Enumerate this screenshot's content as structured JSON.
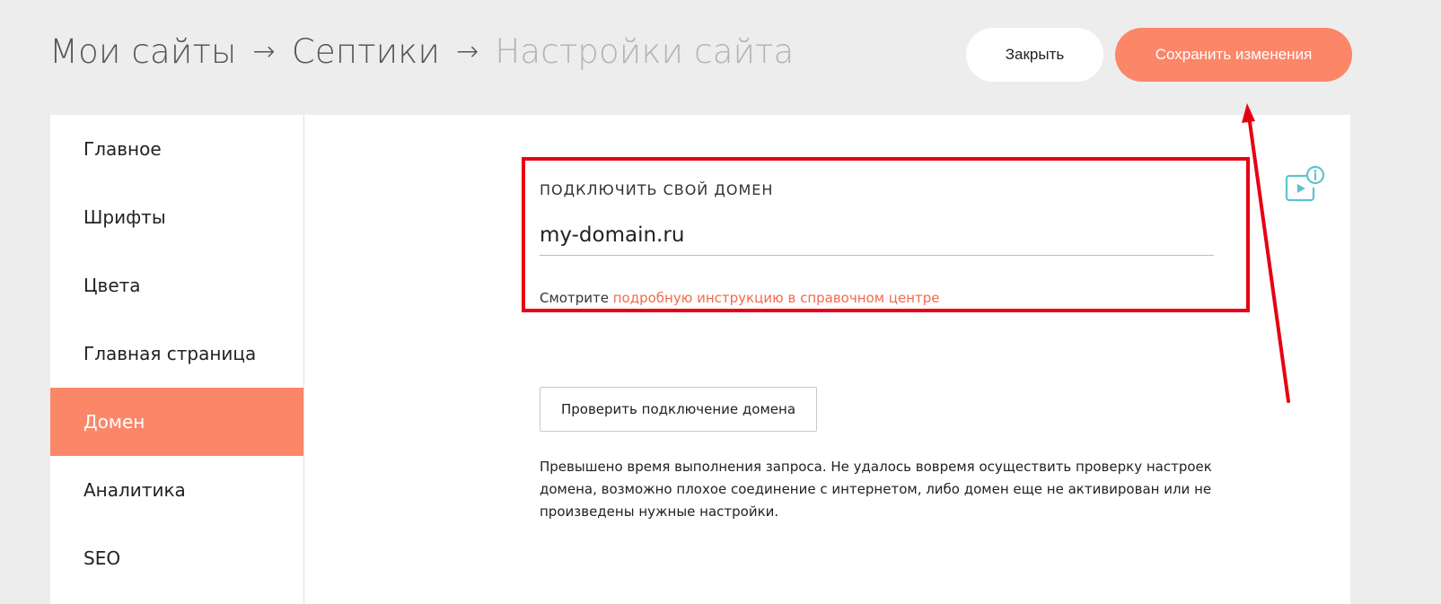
{
  "breadcrumb": {
    "items": [
      "Мои сайты",
      "Септики"
    ],
    "current": "Настройки сайта",
    "separator": "→"
  },
  "header": {
    "close_label": "Закрыть",
    "save_label": "Сохранить изменения"
  },
  "sidebar": {
    "items": [
      {
        "label": "Главное"
      },
      {
        "label": "Шрифты"
      },
      {
        "label": "Цвета"
      },
      {
        "label": "Главная страница"
      },
      {
        "label": "Домен"
      },
      {
        "label": "Аналитика"
      },
      {
        "label": "SEO"
      }
    ],
    "active_index": 4
  },
  "domain": {
    "section_label": "ПОДКЛЮЧИТЬ СВОЙ ДОМЕН",
    "value": "my-domain.ru",
    "help_prefix": "Смотрите",
    "help_link": "подробную инструкцию в справочном центре",
    "check_button": "Проверить подключение домена",
    "error_message": "Превышено время выполнения запроса. Не удалось вовремя осуществить проверку настроек домена, возможно плохое соединение с интернетом, либо домен еще не активирован или не произведены нужные настройки."
  },
  "icons": {
    "video_help": "video-info-icon"
  },
  "colors": {
    "accent": "#fb8668",
    "link": "#f26a4b",
    "annotation": "#e60012",
    "icon": "#5bc4cf"
  }
}
